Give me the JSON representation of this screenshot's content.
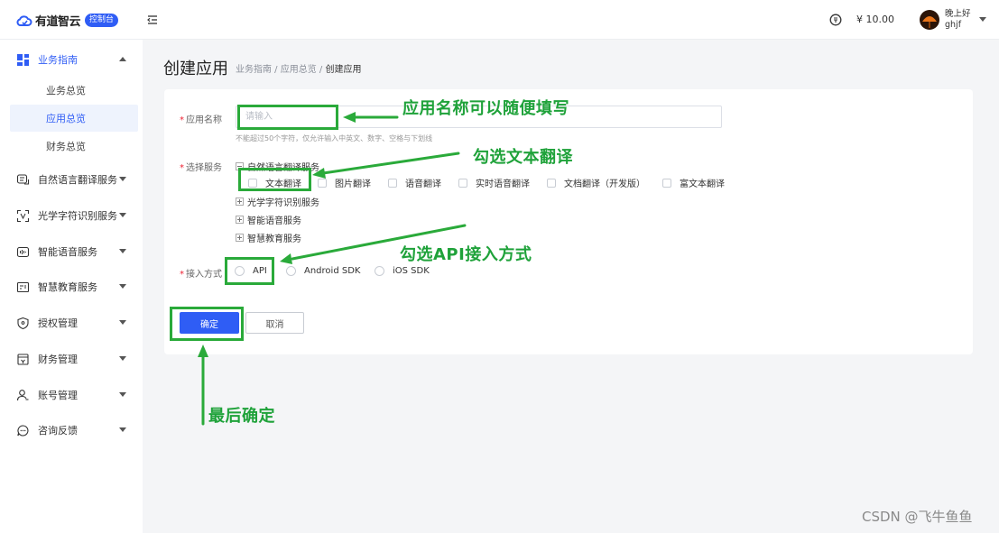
{
  "header": {
    "logo_text": "有道智云",
    "logo_badge": "控制台",
    "balance": "¥ 10.00",
    "greeting": "晚上好",
    "username": "ghjf"
  },
  "sidebar": {
    "group_main": {
      "label": "业务指南"
    },
    "sub_items": [
      {
        "label": "业务总览"
      },
      {
        "label": "应用总览"
      },
      {
        "label": "财务总览"
      }
    ],
    "items": [
      {
        "label": "自然语言翻译服务"
      },
      {
        "label": "光学字符识别服务"
      },
      {
        "label": "智能语音服务"
      },
      {
        "label": "智慧教育服务"
      },
      {
        "label": "授权管理"
      },
      {
        "label": "财务管理"
      },
      {
        "label": "账号管理"
      },
      {
        "label": "咨询反馈"
      }
    ]
  },
  "page": {
    "title": "创建应用",
    "breadcrumb": {
      "part1": "业务指南 / 应用总览 / ",
      "current": "创建应用"
    }
  },
  "form": {
    "app_name": {
      "label": "应用名称",
      "placeholder": "请输入",
      "hint": "不能超过50个字符，仅允许输入中英文、数字、空格与下划线"
    },
    "service": {
      "label": "选择服务",
      "groups": [
        {
          "label": "自然语言翻译服务"
        },
        {
          "label": "光学字符识别服务"
        },
        {
          "label": "智能语音服务"
        },
        {
          "label": "智慧教育服务"
        }
      ],
      "options": [
        {
          "label": "文本翻译"
        },
        {
          "label": "图片翻译"
        },
        {
          "label": "语音翻译"
        },
        {
          "label": "实时语音翻译"
        },
        {
          "label": "文档翻译（开发版）"
        },
        {
          "label": "富文本翻译"
        }
      ]
    },
    "access": {
      "label": "接入方式",
      "options": [
        {
          "label": "API"
        },
        {
          "label": "Android SDK"
        },
        {
          "label": "iOS SDK"
        }
      ]
    },
    "confirm_label": "确定",
    "cancel_label": "取消"
  },
  "annotations": {
    "app_name": "应用名称可以随便填写",
    "text_translate": "勾选文本翻译",
    "api": "勾选API接入方式",
    "confirm": "最后确定"
  },
  "watermark": "CSDN @飞牛鱼鱼",
  "colors": {
    "primary": "#2f5df5",
    "annotation": "#1fa23a"
  }
}
